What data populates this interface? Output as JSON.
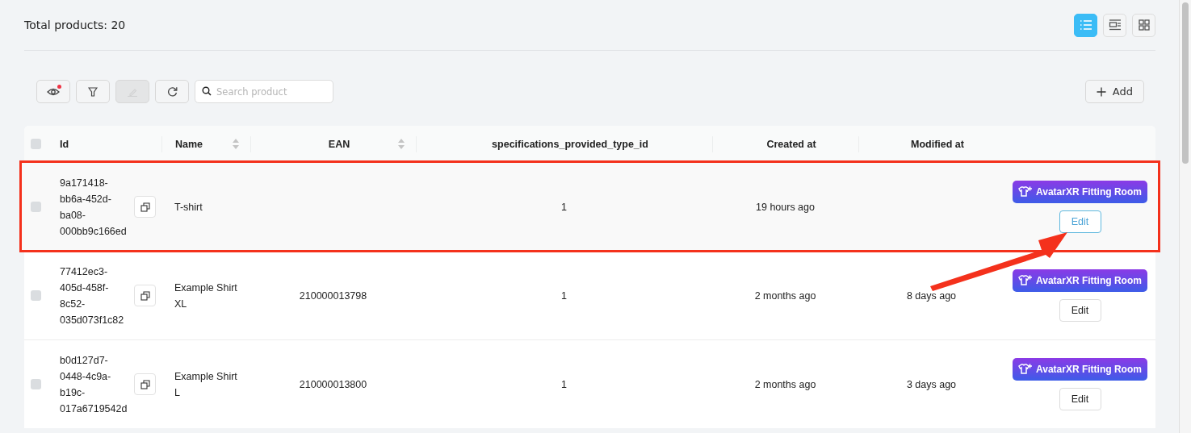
{
  "header": {
    "title": "Total products: 20",
    "views": [
      {
        "kind": "list",
        "selected": true
      },
      {
        "kind": "detail",
        "selected": false
      },
      {
        "kind": "grid",
        "selected": false
      }
    ]
  },
  "toolbar": {
    "tools": [
      {
        "kind": "eye",
        "disabled": false,
        "badge": true
      },
      {
        "kind": "filter",
        "disabled": false,
        "badge": false
      },
      {
        "kind": "edit",
        "disabled": true,
        "badge": false
      },
      {
        "kind": "refresh",
        "disabled": false,
        "badge": false
      }
    ],
    "search": {
      "placeholder": "Search product"
    },
    "add_button": "Add"
  },
  "table": {
    "select_all_checked": false,
    "columns": [
      {
        "label": "Id",
        "sortable": false
      },
      {
        "label": "Name",
        "sortable": true
      },
      {
        "label": "EAN",
        "sortable": true
      },
      {
        "label": "specifications_provided_type_id",
        "sortable": false
      },
      {
        "label": "Created at",
        "sortable": false
      },
      {
        "label": "Modified at",
        "sortable": false
      }
    ],
    "rows": [
      {
        "checked": false,
        "highlighted": true,
        "id": [
          "9a171418-",
          "bb6a-452d-",
          "ba08-",
          "000bb9c166ed"
        ],
        "name": "T-shirt",
        "ean": "",
        "spec": "1",
        "created": "19 hours ago",
        "modified": "",
        "fitting_button": "AvatarXR Fitting Room",
        "edit_button": "Edit",
        "edit_hovered": true
      },
      {
        "checked": false,
        "highlighted": false,
        "id": [
          "77412ec3-",
          "405d-458f-",
          "8c52-",
          "035d073f1c82"
        ],
        "name": "Example Shirt XL",
        "ean": "210000013798",
        "spec": "1",
        "created": "2 months ago",
        "modified": "8 days ago",
        "fitting_button": "AvatarXR Fitting Room",
        "edit_button": "Edit",
        "edit_hovered": false
      },
      {
        "checked": false,
        "highlighted": false,
        "id": [
          "b0d127d7-",
          "0448-4c9a-",
          "b19c-",
          "017a6719542d"
        ],
        "name": "Example Shirt L",
        "ean": "210000013800",
        "spec": "1",
        "created": "2 months ago",
        "modified": "3 days ago",
        "fitting_button": "AvatarXR Fitting Room",
        "edit_button": "Edit",
        "edit_hovered": false
      }
    ]
  }
}
